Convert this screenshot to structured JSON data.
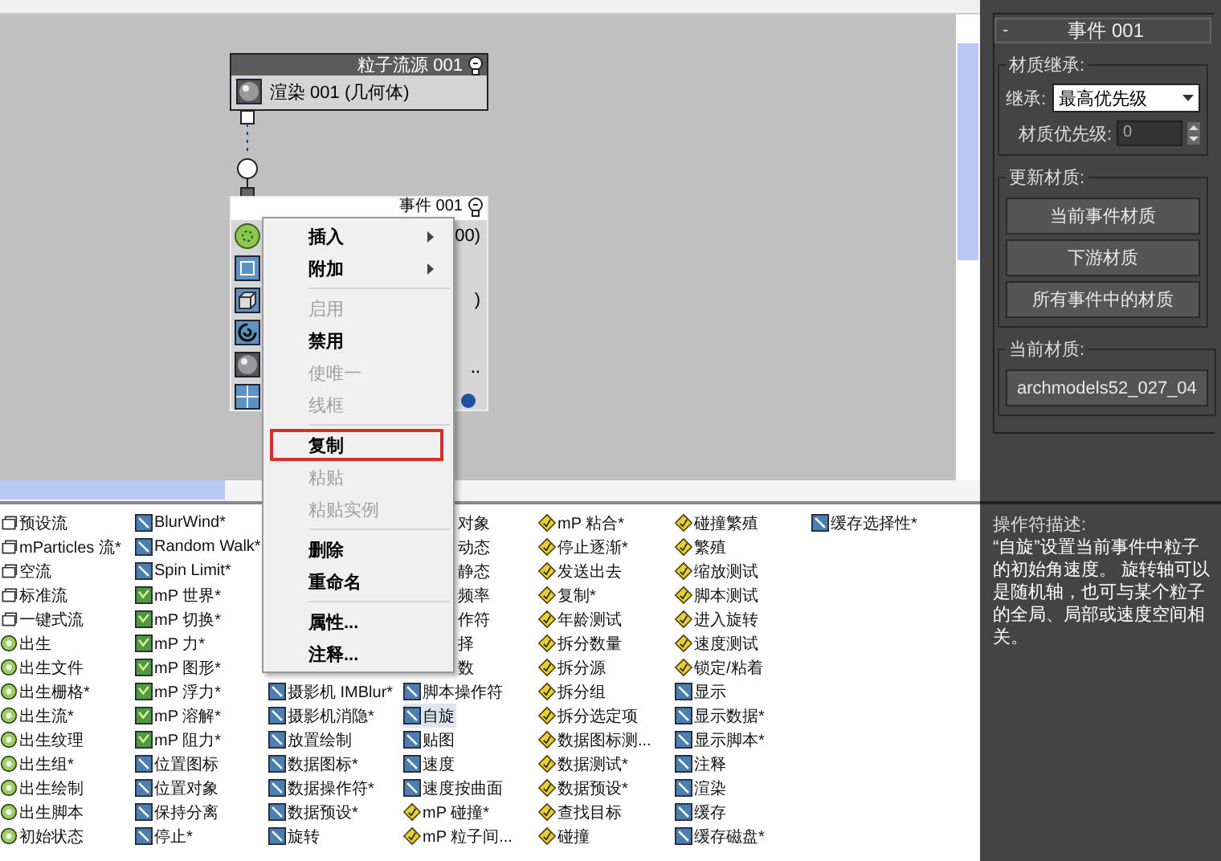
{
  "canvas": {
    "source_node": {
      "title": "粒子流源 001",
      "row": "渲染 001 (几何体)"
    },
    "event_node": {
      "title": "事件 001",
      "rows": [
        {
          "kind": "birth",
          "tail": "00)"
        },
        {
          "kind": "frame"
        },
        {
          "kind": "cube",
          "tail": ")"
        },
        {
          "kind": "spin"
        },
        {
          "kind": "sphere",
          "tail": "‥"
        },
        {
          "kind": "grid"
        }
      ]
    }
  },
  "context_menu": {
    "groups": [
      [
        {
          "label": "插入",
          "disabled": false,
          "submenu": true,
          "marked": false
        },
        {
          "label": "附加",
          "disabled": false,
          "submenu": true,
          "marked": false
        }
      ],
      [
        {
          "label": "启用",
          "disabled": true,
          "submenu": false,
          "marked": false
        },
        {
          "label": "禁用",
          "disabled": false,
          "submenu": false,
          "marked": false
        },
        {
          "label": "使唯一",
          "disabled": true,
          "submenu": false,
          "marked": false
        },
        {
          "label": "线框",
          "disabled": true,
          "submenu": false,
          "marked": false
        }
      ],
      [
        {
          "label": "复制",
          "disabled": false,
          "submenu": false,
          "marked": true
        },
        {
          "label": "粘贴",
          "disabled": true,
          "submenu": false,
          "marked": false
        },
        {
          "label": "粘贴实例",
          "disabled": true,
          "submenu": false,
          "marked": false
        }
      ],
      [
        {
          "label": "删除",
          "disabled": false,
          "submenu": false,
          "marked": false
        },
        {
          "label": "重命名",
          "disabled": false,
          "submenu": false,
          "marked": false
        }
      ],
      [
        {
          "label": "属性...",
          "disabled": false,
          "submenu": false,
          "marked": false
        },
        {
          "label": "注释...",
          "disabled": false,
          "submenu": false,
          "marked": false
        }
      ]
    ]
  },
  "properties": {
    "title": "事件 001",
    "collapse": "-",
    "inherit_group": {
      "label": "材质继承:",
      "inherit_label": "继承:",
      "inherit_value": "最高优先级",
      "priority_label": "材质优先级:",
      "priority_value": "0"
    },
    "update_group": {
      "label": "更新材质:",
      "buttons": [
        "当前事件材质",
        "下游材质",
        "所有事件中的材质"
      ]
    },
    "current_group": {
      "label": "当前材质:",
      "button": "archmodels52_027_04"
    }
  },
  "depot": {
    "columns": [
      {
        "items": [
          {
            "label": "预设流",
            "kind": "flow",
            "selected": false
          },
          {
            "label": "mParticles 流*",
            "kind": "flow",
            "selected": false
          },
          {
            "label": "空流",
            "kind": "flow",
            "selected": false
          },
          {
            "label": "标准流",
            "kind": "flow",
            "selected": false
          },
          {
            "label": "一键式流",
            "kind": "flow",
            "selected": false
          },
          {
            "label": "出生",
            "kind": "birth",
            "selected": false
          },
          {
            "label": "出生文件",
            "kind": "birth",
            "selected": false
          },
          {
            "label": "出生栅格*",
            "kind": "birth",
            "selected": false
          },
          {
            "label": "出生流*",
            "kind": "birth",
            "selected": false
          },
          {
            "label": "出生纹理",
            "kind": "birth",
            "selected": false
          },
          {
            "label": "出生组*",
            "kind": "birth",
            "selected": false
          },
          {
            "label": "出生绘制",
            "kind": "birth",
            "selected": false
          },
          {
            "label": "出生脚本",
            "kind": "birth",
            "selected": false
          },
          {
            "label": "初始状态",
            "kind": "birth",
            "selected": false
          }
        ]
      },
      {
        "items": [
          {
            "label": "BlurWind*",
            "kind": "op",
            "selected": false
          },
          {
            "label": "Random Walk*",
            "kind": "op",
            "selected": false
          },
          {
            "label": "Spin Limit*",
            "kind": "op",
            "selected": false
          },
          {
            "label": "mP 世界*",
            "kind": "mp",
            "selected": false
          },
          {
            "label": "mP 切换*",
            "kind": "mp",
            "selected": false
          },
          {
            "label": "mP 力*",
            "kind": "mp",
            "selected": false
          },
          {
            "label": "mP 图形*",
            "kind": "mp",
            "selected": false
          },
          {
            "label": "mP 浮力*",
            "kind": "mp",
            "selected": false
          },
          {
            "label": "mP 溶解*",
            "kind": "mp",
            "selected": false
          },
          {
            "label": "mP 阻力*",
            "kind": "mp",
            "selected": false
          },
          {
            "label": "位置图标",
            "kind": "op",
            "selected": false
          },
          {
            "label": "位置对象",
            "kind": "op",
            "selected": false
          },
          {
            "label": "保持分离",
            "kind": "op",
            "selected": false
          },
          {
            "label": "停止*",
            "kind": "op",
            "selected": false
          }
        ]
      },
      {
        "items": [
          {
            "label": "摄影机 IMBlur*",
            "kind": "op",
            "selected": false
          },
          {
            "label": "摄影机消隐*",
            "kind": "op",
            "selected": false
          },
          {
            "label": "放置绘制",
            "kind": "op",
            "selected": false
          },
          {
            "label": "数据图标*",
            "kind": "op",
            "selected": false
          },
          {
            "label": "数据操作符*",
            "kind": "op",
            "selected": false
          },
          {
            "label": "数据预设*",
            "kind": "op",
            "selected": false
          },
          {
            "label": "旋转",
            "kind": "op",
            "selected": false
          }
        ]
      },
      {
        "items": [
          {
            "label": "对象",
            "kind": "tail",
            "selected": false
          },
          {
            "label": "动态",
            "kind": "tail",
            "selected": false
          },
          {
            "label": "静态",
            "kind": "tail",
            "selected": false
          },
          {
            "label": "频率",
            "kind": "tail",
            "selected": false
          },
          {
            "label": "作符",
            "kind": "tail",
            "selected": false
          },
          {
            "label": "择",
            "kind": "tail",
            "selected": false
          },
          {
            "label": "数",
            "kind": "tail",
            "selected": false
          },
          {
            "label": "脚本操作符",
            "kind": "op",
            "selected": false
          },
          {
            "label": "自旋",
            "kind": "op",
            "selected": true
          },
          {
            "label": "贴图",
            "kind": "op",
            "selected": false
          },
          {
            "label": "速度",
            "kind": "op",
            "selected": false
          },
          {
            "label": "速度按曲面",
            "kind": "op",
            "selected": false
          },
          {
            "label": "mP 碰撞*",
            "kind": "test",
            "selected": false
          },
          {
            "label": "mP 粒子间...",
            "kind": "test",
            "selected": false
          }
        ]
      },
      {
        "items": [
          {
            "label": "mP 粘合*",
            "kind": "test",
            "selected": false
          },
          {
            "label": "停止逐渐*",
            "kind": "test",
            "selected": false
          },
          {
            "label": "发送出去",
            "kind": "test",
            "selected": false
          },
          {
            "label": "复制*",
            "kind": "test",
            "selected": false
          },
          {
            "label": "年龄测试",
            "kind": "test",
            "selected": false
          },
          {
            "label": "拆分数量",
            "kind": "test",
            "selected": false
          },
          {
            "label": "拆分源",
            "kind": "test",
            "selected": false
          },
          {
            "label": "拆分组",
            "kind": "test",
            "selected": false
          },
          {
            "label": "拆分选定项",
            "kind": "test",
            "selected": false
          },
          {
            "label": "数据图标测...",
            "kind": "test",
            "selected": false
          },
          {
            "label": "数据测试*",
            "kind": "test",
            "selected": false
          },
          {
            "label": "数据预设*",
            "kind": "test",
            "selected": false
          },
          {
            "label": "查找目标",
            "kind": "test",
            "selected": false
          },
          {
            "label": "碰撞",
            "kind": "test",
            "selected": false
          }
        ]
      },
      {
        "items": [
          {
            "label": "碰撞繁殖",
            "kind": "test",
            "selected": false
          },
          {
            "label": "繁殖",
            "kind": "test",
            "selected": false
          },
          {
            "label": "缩放测试",
            "kind": "test",
            "selected": false
          },
          {
            "label": "脚本测试",
            "kind": "test",
            "selected": false
          },
          {
            "label": "进入旋转",
            "kind": "test",
            "selected": false
          },
          {
            "label": "速度测试",
            "kind": "test",
            "selected": false
          },
          {
            "label": "锁定/粘着",
            "kind": "test",
            "selected": false
          },
          {
            "label": "显示",
            "kind": "op",
            "selected": false
          },
          {
            "label": "显示数据*",
            "kind": "op",
            "selected": false
          },
          {
            "label": "显示脚本*",
            "kind": "op",
            "selected": false
          },
          {
            "label": "注释",
            "kind": "op",
            "selected": false
          },
          {
            "label": "渲染",
            "kind": "op",
            "selected": false
          },
          {
            "label": "缓存",
            "kind": "op",
            "selected": false
          },
          {
            "label": "缓存磁盘*",
            "kind": "op",
            "selected": false
          }
        ]
      },
      {
        "items": [
          {
            "label": "缓存选择性*",
            "kind": "op",
            "selected": false
          }
        ]
      }
    ]
  },
  "description": {
    "label": "操作符描述:",
    "text": "“自旋”设置当前事件中粒子的初始角速度。 旋转轴可以是随机轴，也可与某个粒子的全局、局部或速度空间相关。"
  }
}
